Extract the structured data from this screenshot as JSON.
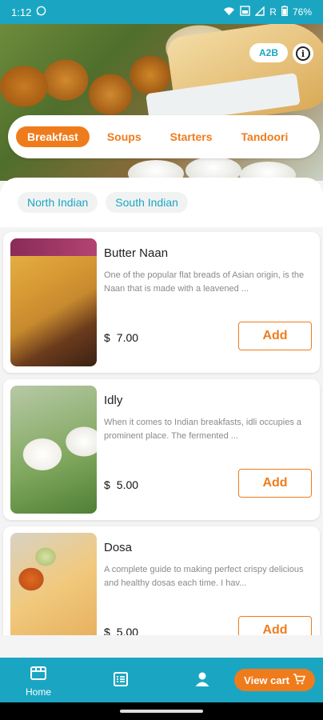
{
  "status_bar": {
    "time": "1:12",
    "signal_text": "R",
    "battery": "76%"
  },
  "hero": {
    "brand_badge": "A2B"
  },
  "categories": [
    {
      "label": "Breakfast",
      "active": true
    },
    {
      "label": "Soups",
      "active": false
    },
    {
      "label": "Starters",
      "active": false
    },
    {
      "label": "Tandoori",
      "active": false
    }
  ],
  "subcategories": [
    {
      "label": "North Indian"
    },
    {
      "label": "South Indian"
    }
  ],
  "items": [
    {
      "name": "Butter Naan",
      "description": "One of the popular flat breads of Asian origin, is the Naan that is made with a leavened ...",
      "currency": "$",
      "price": "7.00",
      "button": "Add"
    },
    {
      "name": "Idly",
      "description": "When it comes to Indian breakfasts, idli occupies a prominent place. The fermented ...",
      "currency": "$",
      "price": "5.00",
      "button": "Add"
    },
    {
      "name": "Dosa",
      "description": "A complete guide to making perfect crispy delicious and healthy dosas each time. I hav...",
      "currency": "$",
      "price": "5.00",
      "button": "Add"
    }
  ],
  "bottom_nav": {
    "home_label": "Home",
    "view_cart_label": "View cart"
  },
  "colors": {
    "accent": "#ef7c1c",
    "primary": "#1aa6c2"
  }
}
